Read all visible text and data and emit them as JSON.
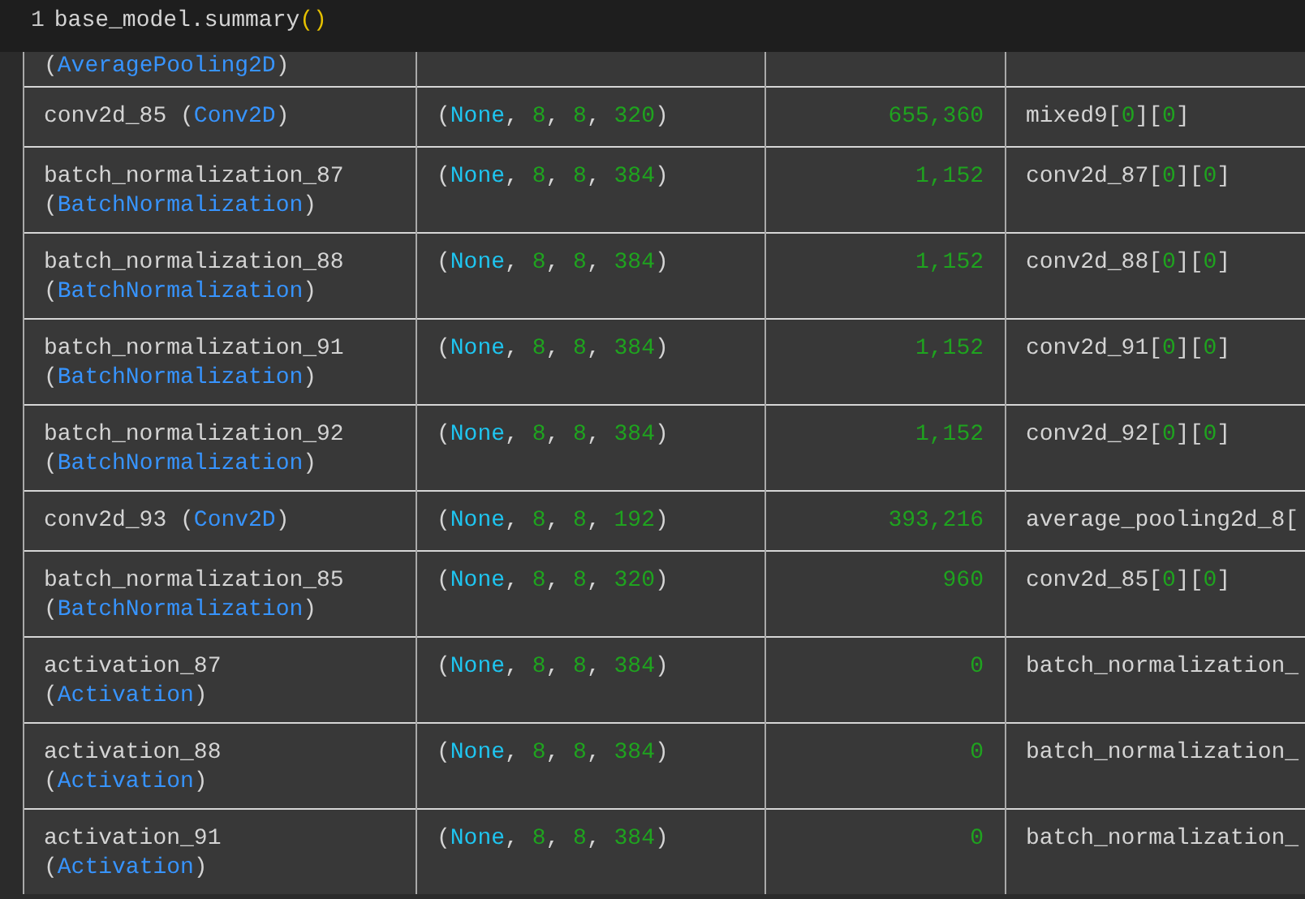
{
  "code_line": {
    "line_number": "1",
    "tokens": [
      {
        "text": "base_model.summary",
        "kind": "plain"
      },
      {
        "text": "()",
        "kind": "call"
      }
    ]
  },
  "rows": [
    {
      "layer": [
        {
          "text": "(",
          "kind": "plain"
        },
        {
          "text": "AveragePooling2D",
          "kind": "type"
        },
        {
          "text": ")",
          "kind": "plain"
        }
      ],
      "output_shape": [],
      "params": [],
      "connected_to": []
    },
    {
      "layer": [
        {
          "text": "conv2d_85 (",
          "kind": "plain"
        },
        {
          "text": "Conv2D",
          "kind": "type"
        },
        {
          "text": ")",
          "kind": "plain"
        }
      ],
      "output_shape": [
        {
          "text": "(",
          "kind": "plain"
        },
        {
          "text": "None",
          "kind": "none"
        },
        {
          "text": ", ",
          "kind": "plain"
        },
        {
          "text": "8",
          "kind": "num"
        },
        {
          "text": ", ",
          "kind": "plain"
        },
        {
          "text": "8",
          "kind": "num"
        },
        {
          "text": ", ",
          "kind": "plain"
        },
        {
          "text": "320",
          "kind": "num"
        },
        {
          "text": ")",
          "kind": "plain"
        }
      ],
      "params": [
        {
          "text": "655,360",
          "kind": "num"
        }
      ],
      "connected_to": [
        {
          "text": "mixed9[",
          "kind": "plain"
        },
        {
          "text": "0",
          "kind": "num"
        },
        {
          "text": "][",
          "kind": "plain"
        },
        {
          "text": "0",
          "kind": "num"
        },
        {
          "text": "]",
          "kind": "plain"
        }
      ]
    },
    {
      "layer": [
        {
          "text": "batch_normalization_87 (",
          "kind": "plain"
        },
        {
          "text": "BatchNormalization",
          "kind": "type"
        },
        {
          "text": ")",
          "kind": "plain"
        }
      ],
      "output_shape": [
        {
          "text": "(",
          "kind": "plain"
        },
        {
          "text": "None",
          "kind": "none"
        },
        {
          "text": ", ",
          "kind": "plain"
        },
        {
          "text": "8",
          "kind": "num"
        },
        {
          "text": ", ",
          "kind": "plain"
        },
        {
          "text": "8",
          "kind": "num"
        },
        {
          "text": ", ",
          "kind": "plain"
        },
        {
          "text": "384",
          "kind": "num"
        },
        {
          "text": ")",
          "kind": "plain"
        }
      ],
      "params": [
        {
          "text": "1,152",
          "kind": "num"
        }
      ],
      "connected_to": [
        {
          "text": "conv2d_87[",
          "kind": "plain"
        },
        {
          "text": "0",
          "kind": "num"
        },
        {
          "text": "][",
          "kind": "plain"
        },
        {
          "text": "0",
          "kind": "num"
        },
        {
          "text": "]",
          "kind": "plain"
        }
      ]
    },
    {
      "layer": [
        {
          "text": "batch_normalization_88 (",
          "kind": "plain"
        },
        {
          "text": "BatchNormalization",
          "kind": "type"
        },
        {
          "text": ")",
          "kind": "plain"
        }
      ],
      "output_shape": [
        {
          "text": "(",
          "kind": "plain"
        },
        {
          "text": "None",
          "kind": "none"
        },
        {
          "text": ", ",
          "kind": "plain"
        },
        {
          "text": "8",
          "kind": "num"
        },
        {
          "text": ", ",
          "kind": "plain"
        },
        {
          "text": "8",
          "kind": "num"
        },
        {
          "text": ", ",
          "kind": "plain"
        },
        {
          "text": "384",
          "kind": "num"
        },
        {
          "text": ")",
          "kind": "plain"
        }
      ],
      "params": [
        {
          "text": "1,152",
          "kind": "num"
        }
      ],
      "connected_to": [
        {
          "text": "conv2d_88[",
          "kind": "plain"
        },
        {
          "text": "0",
          "kind": "num"
        },
        {
          "text": "][",
          "kind": "plain"
        },
        {
          "text": "0",
          "kind": "num"
        },
        {
          "text": "]",
          "kind": "plain"
        }
      ]
    },
    {
      "layer": [
        {
          "text": "batch_normalization_91 (",
          "kind": "plain"
        },
        {
          "text": "BatchNormalization",
          "kind": "type"
        },
        {
          "text": ")",
          "kind": "plain"
        }
      ],
      "output_shape": [
        {
          "text": "(",
          "kind": "plain"
        },
        {
          "text": "None",
          "kind": "none"
        },
        {
          "text": ", ",
          "kind": "plain"
        },
        {
          "text": "8",
          "kind": "num"
        },
        {
          "text": ", ",
          "kind": "plain"
        },
        {
          "text": "8",
          "kind": "num"
        },
        {
          "text": ", ",
          "kind": "plain"
        },
        {
          "text": "384",
          "kind": "num"
        },
        {
          "text": ")",
          "kind": "plain"
        }
      ],
      "params": [
        {
          "text": "1,152",
          "kind": "num"
        }
      ],
      "connected_to": [
        {
          "text": "conv2d_91[",
          "kind": "plain"
        },
        {
          "text": "0",
          "kind": "num"
        },
        {
          "text": "][",
          "kind": "plain"
        },
        {
          "text": "0",
          "kind": "num"
        },
        {
          "text": "]",
          "kind": "plain"
        }
      ]
    },
    {
      "layer": [
        {
          "text": "batch_normalization_92 (",
          "kind": "plain"
        },
        {
          "text": "BatchNormalization",
          "kind": "type"
        },
        {
          "text": ")",
          "kind": "plain"
        }
      ],
      "output_shape": [
        {
          "text": "(",
          "kind": "plain"
        },
        {
          "text": "None",
          "kind": "none"
        },
        {
          "text": ", ",
          "kind": "plain"
        },
        {
          "text": "8",
          "kind": "num"
        },
        {
          "text": ", ",
          "kind": "plain"
        },
        {
          "text": "8",
          "kind": "num"
        },
        {
          "text": ", ",
          "kind": "plain"
        },
        {
          "text": "384",
          "kind": "num"
        },
        {
          "text": ")",
          "kind": "plain"
        }
      ],
      "params": [
        {
          "text": "1,152",
          "kind": "num"
        }
      ],
      "connected_to": [
        {
          "text": "conv2d_92[",
          "kind": "plain"
        },
        {
          "text": "0",
          "kind": "num"
        },
        {
          "text": "][",
          "kind": "plain"
        },
        {
          "text": "0",
          "kind": "num"
        },
        {
          "text": "]",
          "kind": "plain"
        }
      ]
    },
    {
      "layer": [
        {
          "text": "conv2d_93 (",
          "kind": "plain"
        },
        {
          "text": "Conv2D",
          "kind": "type"
        },
        {
          "text": ")",
          "kind": "plain"
        }
      ],
      "output_shape": [
        {
          "text": "(",
          "kind": "plain"
        },
        {
          "text": "None",
          "kind": "none"
        },
        {
          "text": ", ",
          "kind": "plain"
        },
        {
          "text": "8",
          "kind": "num"
        },
        {
          "text": ", ",
          "kind": "plain"
        },
        {
          "text": "8",
          "kind": "num"
        },
        {
          "text": ", ",
          "kind": "plain"
        },
        {
          "text": "192",
          "kind": "num"
        },
        {
          "text": ")",
          "kind": "plain"
        }
      ],
      "params": [
        {
          "text": "393,216",
          "kind": "num"
        }
      ],
      "connected_to": [
        {
          "text": "average_pooling2d_8[",
          "kind": "plain"
        }
      ]
    },
    {
      "layer": [
        {
          "text": "batch_normalization_85 (",
          "kind": "plain"
        },
        {
          "text": "BatchNormalization",
          "kind": "type"
        },
        {
          "text": ")",
          "kind": "plain"
        }
      ],
      "output_shape": [
        {
          "text": "(",
          "kind": "plain"
        },
        {
          "text": "None",
          "kind": "none"
        },
        {
          "text": ", ",
          "kind": "plain"
        },
        {
          "text": "8",
          "kind": "num"
        },
        {
          "text": ", ",
          "kind": "plain"
        },
        {
          "text": "8",
          "kind": "num"
        },
        {
          "text": ", ",
          "kind": "plain"
        },
        {
          "text": "320",
          "kind": "num"
        },
        {
          "text": ")",
          "kind": "plain"
        }
      ],
      "params": [
        {
          "text": "960",
          "kind": "num"
        }
      ],
      "connected_to": [
        {
          "text": "conv2d_85[",
          "kind": "plain"
        },
        {
          "text": "0",
          "kind": "num"
        },
        {
          "text": "][",
          "kind": "plain"
        },
        {
          "text": "0",
          "kind": "num"
        },
        {
          "text": "]",
          "kind": "plain"
        }
      ]
    },
    {
      "layer": [
        {
          "text": "activation_87 (",
          "kind": "plain"
        },
        {
          "text": "Activation",
          "kind": "type"
        },
        {
          "text": ")",
          "kind": "plain"
        }
      ],
      "output_shape": [
        {
          "text": "(",
          "kind": "plain"
        },
        {
          "text": "None",
          "kind": "none"
        },
        {
          "text": ", ",
          "kind": "plain"
        },
        {
          "text": "8",
          "kind": "num"
        },
        {
          "text": ", ",
          "kind": "plain"
        },
        {
          "text": "8",
          "kind": "num"
        },
        {
          "text": ", ",
          "kind": "plain"
        },
        {
          "text": "384",
          "kind": "num"
        },
        {
          "text": ")",
          "kind": "plain"
        }
      ],
      "params": [
        {
          "text": "0",
          "kind": "num"
        }
      ],
      "connected_to": [
        {
          "text": "batch_normalization_",
          "kind": "plain"
        }
      ]
    },
    {
      "layer": [
        {
          "text": "activation_88 (",
          "kind": "plain"
        },
        {
          "text": "Activation",
          "kind": "type"
        },
        {
          "text": ")",
          "kind": "plain"
        }
      ],
      "output_shape": [
        {
          "text": "(",
          "kind": "plain"
        },
        {
          "text": "None",
          "kind": "none"
        },
        {
          "text": ", ",
          "kind": "plain"
        },
        {
          "text": "8",
          "kind": "num"
        },
        {
          "text": ", ",
          "kind": "plain"
        },
        {
          "text": "8",
          "kind": "num"
        },
        {
          "text": ", ",
          "kind": "plain"
        },
        {
          "text": "384",
          "kind": "num"
        },
        {
          "text": ")",
          "kind": "plain"
        }
      ],
      "params": [
        {
          "text": "0",
          "kind": "num"
        }
      ],
      "connected_to": [
        {
          "text": "batch_normalization_",
          "kind": "plain"
        }
      ]
    },
    {
      "layer": [
        {
          "text": "activation_91 (",
          "kind": "plain"
        },
        {
          "text": "Activation",
          "kind": "type"
        },
        {
          "text": ")",
          "kind": "plain"
        }
      ],
      "output_shape": [
        {
          "text": "(",
          "kind": "plain"
        },
        {
          "text": "None",
          "kind": "none"
        },
        {
          "text": ", ",
          "kind": "plain"
        },
        {
          "text": "8",
          "kind": "num"
        },
        {
          "text": ", ",
          "kind": "plain"
        },
        {
          "text": "8",
          "kind": "num"
        },
        {
          "text": ", ",
          "kind": "plain"
        },
        {
          "text": "384",
          "kind": "num"
        },
        {
          "text": ")",
          "kind": "plain"
        }
      ],
      "params": [
        {
          "text": "0",
          "kind": "num"
        }
      ],
      "connected_to": [
        {
          "text": "batch_normalization_",
          "kind": "plain"
        }
      ]
    }
  ]
}
